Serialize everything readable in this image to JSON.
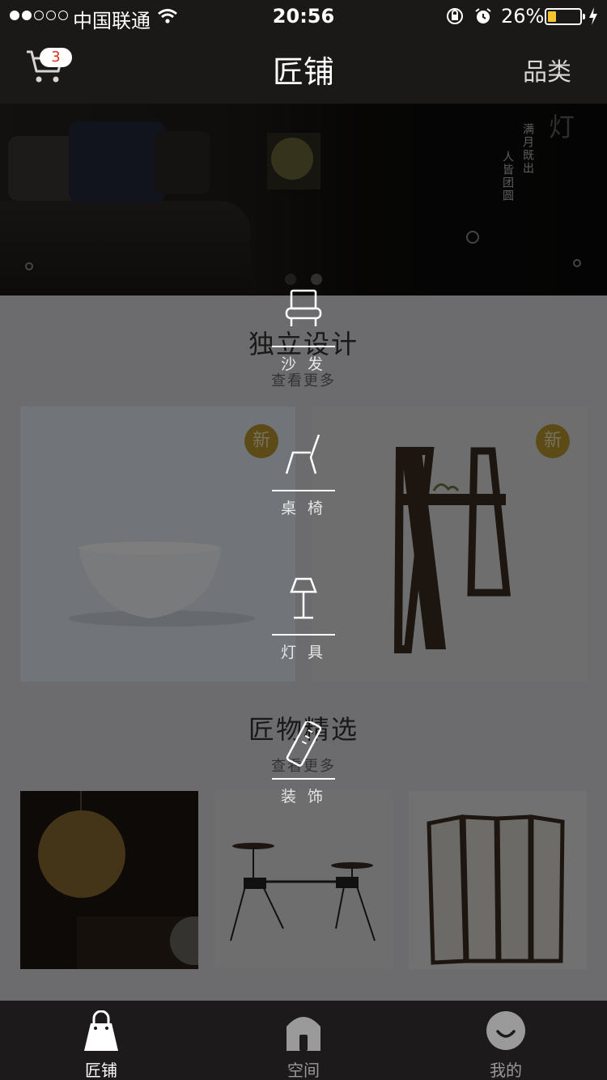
{
  "status_bar": {
    "carrier": "中国联通",
    "time": "20:56",
    "battery_percent": "26%",
    "battery_level": 0.26,
    "signal_bars_filled": 2,
    "signal_bars_total": 5
  },
  "nav": {
    "title": "匠铺",
    "cart_count": "3",
    "category_label": "品类"
  },
  "banner": {
    "lamp_char": "灯",
    "poem_line1": "满月既出",
    "poem_line2": "人皆团圆",
    "page_count": 2,
    "active_page": 1
  },
  "section_design": {
    "title": "独立设计",
    "more_label": "查看更多",
    "new_badge": "新"
  },
  "section_featured": {
    "title": "匠物精选",
    "more_label": "查看更多"
  },
  "category_menu": [
    {
      "label": "沙 发",
      "icon": "sofa-icon"
    },
    {
      "label": "桌 椅",
      "icon": "chair-icon"
    },
    {
      "label": "灯 具",
      "icon": "lamp-icon"
    },
    {
      "label": "装 饰",
      "icon": "decoration-icon"
    }
  ],
  "tabbar": [
    {
      "label": "匠铺",
      "icon": "shopping-bag-icon",
      "active": true
    },
    {
      "label": "空间",
      "icon": "house-icon",
      "active": false
    },
    {
      "label": "我的",
      "icon": "smiley-icon",
      "active": false
    }
  ],
  "colors": {
    "bar_bg": "#1b1818",
    "badge_text": "#e0301e",
    "battery_fill": "#f4c430",
    "new_badge": "#b8952e"
  }
}
